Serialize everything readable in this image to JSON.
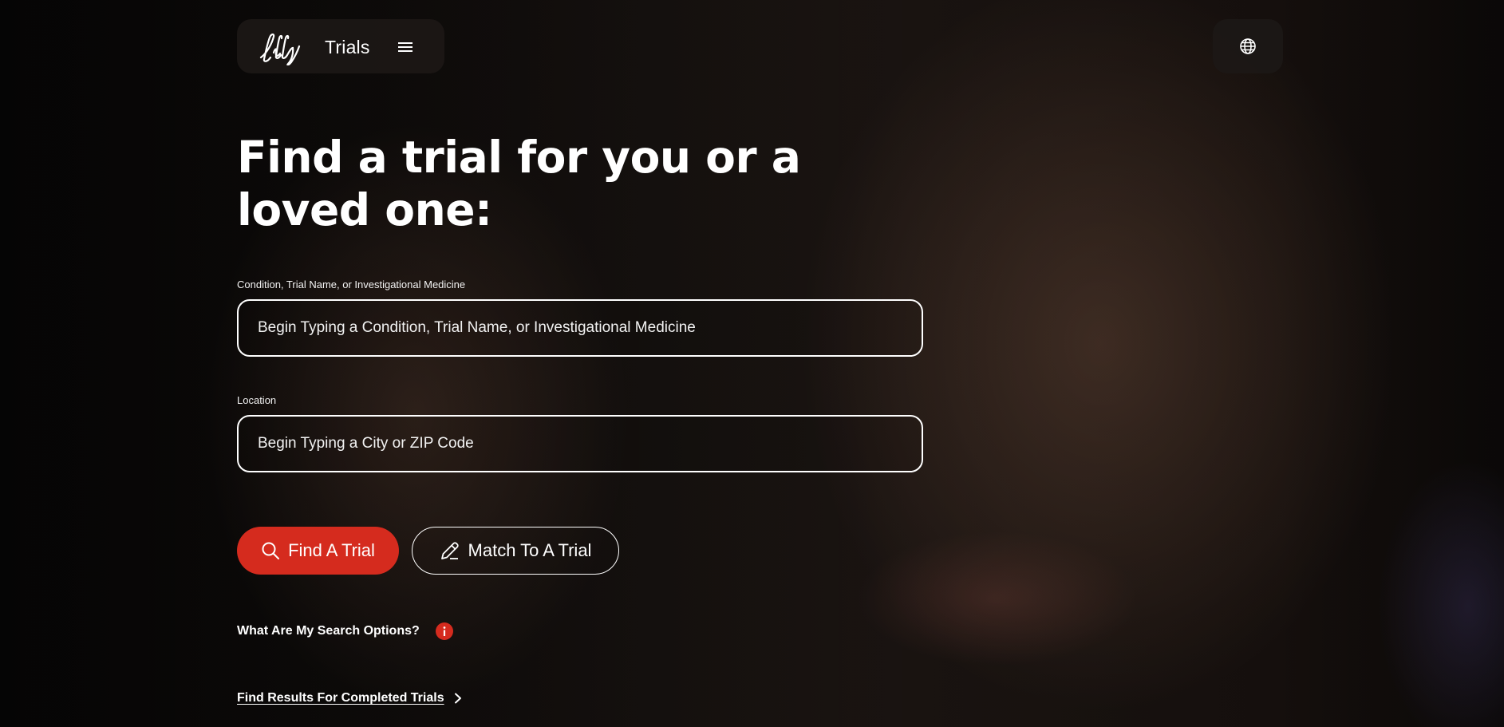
{
  "header": {
    "brand_name": "Lilly",
    "title": "Trials",
    "menu_icon": "hamburger-menu-icon",
    "language_icon": "globe-icon"
  },
  "hero": {
    "headline": "Find a trial for you or a loved one:"
  },
  "search": {
    "condition_label": "Condition, Trial Name, or Investigational Medicine",
    "condition_placeholder": "Begin Typing a Condition, Trial Name, or Investigational Medicine",
    "condition_value": "",
    "location_label": "Location",
    "location_placeholder": "Begin Typing a City or ZIP Code",
    "location_value": ""
  },
  "actions": {
    "find_label": "Find A Trial",
    "find_icon": "search-icon",
    "match_label": "Match To A Trial",
    "match_icon": "pencil-icon"
  },
  "help": {
    "search_options_text": "What Are My Search Options?",
    "info_icon": "info-icon"
  },
  "links": {
    "completed_trials": "Find Results For Completed Trials",
    "completed_icon": "chevron-right-icon"
  },
  "colors": {
    "accent_red": "#d52b1e",
    "text": "#ffffff",
    "pill_bg": "#1c1816"
  }
}
